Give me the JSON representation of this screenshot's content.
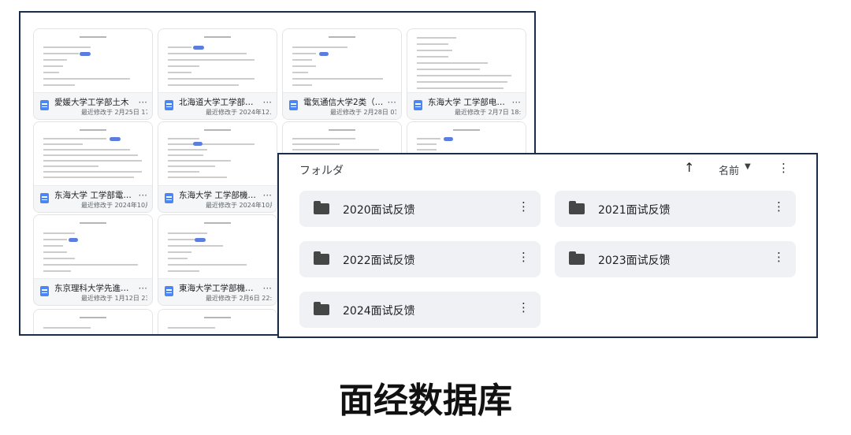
{
  "documents": [
    {
      "name": "愛媛大学工学部土木",
      "date_prefix": "最近修改于",
      "date": "2月25日 17..."
    },
    {
      "name": "北海道大学工学部機械...",
      "date_prefix": "最近修改于",
      "date": "2024年12..."
    },
    {
      "name": "電気通信大学2类（機...",
      "date_prefix": "最近修改于",
      "date": "2月28日 01..."
    },
    {
      "name": "东海大学 工学部电气...",
      "date_prefix": "最近修改于",
      "date": "2月7日 18:43"
    },
    {
      "name": "东海大学 工学部電気...",
      "date_prefix": "最近修改于",
      "date": "2024年10月6日"
    },
    {
      "name": "东海大学 工学部機械...",
      "date_prefix": "最近修改于",
      "date": "2024年10月6日"
    },
    {
      "name": "",
      "date_prefix": "",
      "date": ""
    },
    {
      "name": "",
      "date_prefix": "",
      "date": ""
    },
    {
      "name": "东京理科大学先進工学...",
      "date_prefix": "最近修改于",
      "date": "1月12日 23:..."
    },
    {
      "name": "東海大学工学部機械シ...",
      "date_prefix": "最近修改于",
      "date": "2月6日 22:15"
    }
  ],
  "folder_view": {
    "heading": "フォルダ",
    "sort_label": "名前",
    "folders": [
      {
        "name": "2020面试反馈"
      },
      {
        "name": "2021面试反馈"
      },
      {
        "name": "2022面试反馈"
      },
      {
        "name": "2023面试反馈"
      },
      {
        "name": "2024面试反馈"
      }
    ]
  },
  "caption": "面经数据库",
  "icons": {
    "doc": "doc-icon",
    "folder": "folder-icon",
    "more": "more-vert-icon",
    "sort": "arrow-up-icon",
    "caret": "caret-down-icon"
  },
  "colors": {
    "doc_icon": "#4a86f5",
    "redaction": "#5b7de0",
    "folder_bg": "#eff1f5",
    "window_border": "#1a2e4a"
  }
}
